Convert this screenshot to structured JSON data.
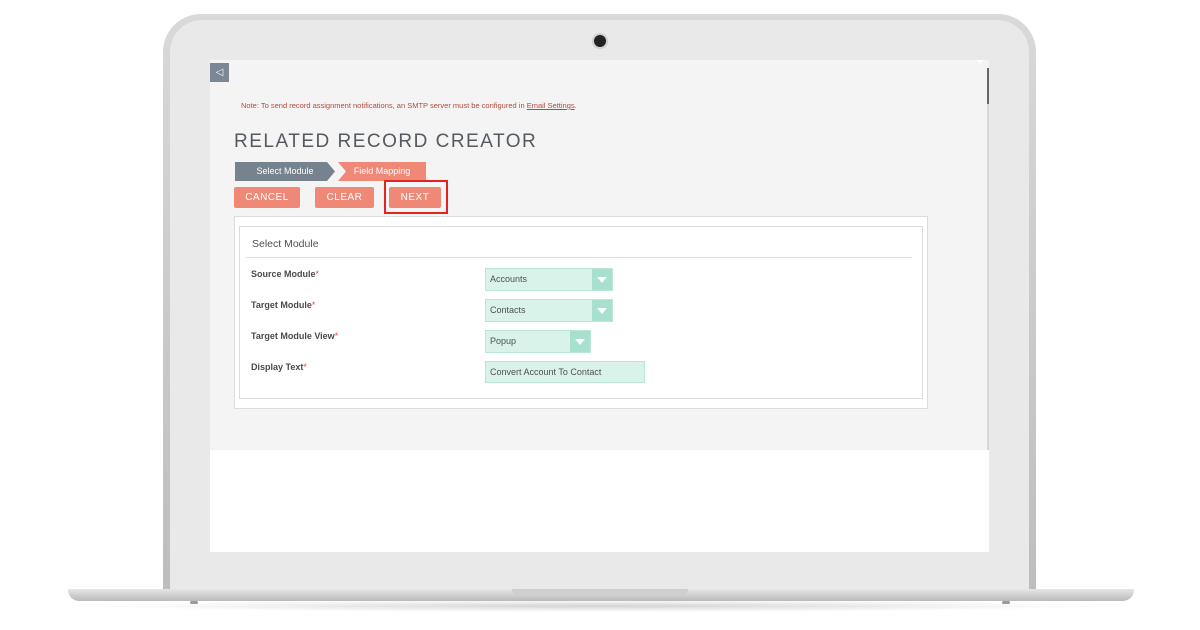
{
  "note": {
    "text": "Note: To send record assignment notifications, an SMTP server must be configured in ",
    "link": "Email Settings",
    "suffix": "."
  },
  "page": {
    "title": "RELATED RECORD CREATOR"
  },
  "wizard": {
    "steps": [
      {
        "label": "Select Module"
      },
      {
        "label": "Field Mapping"
      }
    ]
  },
  "actions": {
    "cancel": "CANCEL",
    "clear": "CLEAR",
    "next": "NEXT"
  },
  "panel": {
    "title": "Select Module",
    "fields": [
      {
        "label": "Source Module",
        "required": "*",
        "value": "Accounts"
      },
      {
        "label": "Target Module",
        "required": "*",
        "value": "Contacts"
      },
      {
        "label": "Target Module View",
        "required": "*",
        "value": "Popup"
      },
      {
        "label": "Display Text",
        "required": "*",
        "value": "Convert Account To Contact"
      }
    ]
  },
  "icons": {
    "back": "back-arrow-icon",
    "dropdown": "chevron-down-icon"
  },
  "colors": {
    "accent": "#f08877",
    "step_inactive": "#76828e",
    "field_bg": "#d9f3eb",
    "highlight": "#e32222"
  }
}
